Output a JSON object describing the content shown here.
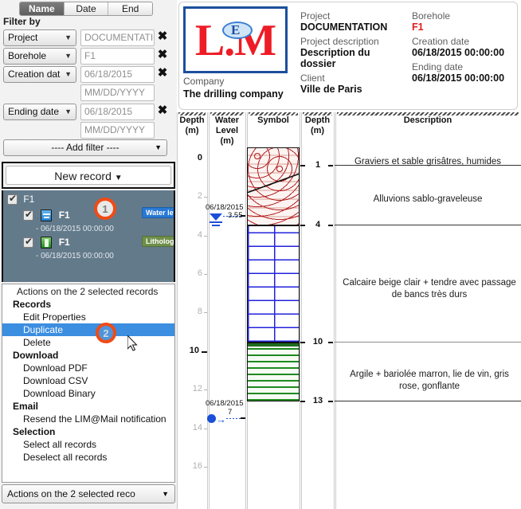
{
  "tabs": [
    {
      "label": "Name",
      "active": true
    },
    {
      "label": "Date",
      "active": false
    },
    {
      "label": "End",
      "active": false
    }
  ],
  "filter": {
    "title": "Filter by",
    "rows": [
      {
        "field": "Project",
        "value": "DOCUMENTATION",
        "placeholder": "",
        "second": null
      },
      {
        "field": "Borehole",
        "value": "F1",
        "placeholder": "",
        "second": null
      },
      {
        "field": "Creation dat",
        "value": "06/18/2015",
        "placeholder": "",
        "second": "MM/DD/YYYY"
      },
      {
        "field": "Ending date",
        "value": "06/18/2015",
        "placeholder": "",
        "second": "MM/DD/YYYY"
      }
    ],
    "add_filter": "---- Add filter ----",
    "clear_icon": "✖"
  },
  "new_record": {
    "label": "New record",
    "caret": "▾"
  },
  "records": {
    "root": {
      "label": "F1"
    },
    "items": [
      {
        "label": "F1",
        "sub": "- 06/18/2015 00:00:00",
        "icon": "water-level-icon",
        "badge": "Water level"
      },
      {
        "label": "F1",
        "sub": "- 06/18/2015 00:00:00",
        "icon": "lithology-icon",
        "badge": "Lithology"
      }
    ]
  },
  "actions_menu": {
    "header": "Actions on the 2 selected records",
    "groups": [
      {
        "title": "Records",
        "items": [
          "Edit Properties",
          "Duplicate",
          "Delete"
        ]
      },
      {
        "title": "Download",
        "items": [
          "Download PDF",
          "Download CSV",
          "Download Binary"
        ]
      },
      {
        "title": "Email",
        "items": [
          "Resend the LIM@Mail notification"
        ]
      },
      {
        "title": "Selection",
        "items": [
          "Select all records",
          "Deselect all records"
        ]
      }
    ],
    "selected": "Duplicate"
  },
  "actions_select": {
    "label": "Actions on the 2 selected reco",
    "caret": "▾"
  },
  "callouts": [
    {
      "number": "1"
    },
    {
      "number": "2"
    }
  ],
  "info_card": {
    "logo_text": "L.M",
    "logo_inner": "E",
    "company_label": "Company",
    "company_value": "The drilling company",
    "fields": [
      {
        "label": "Project",
        "value": "DOCUMENTATION",
        "red": false
      },
      {
        "label": "Project description",
        "value": "Description du dossier",
        "red": false
      },
      {
        "label": "Client",
        "value": "Ville de Paris",
        "red": false
      },
      {
        "label": "Borehole",
        "value": "F1",
        "red": true
      },
      {
        "label": "Creation date",
        "value": "06/18/2015 00:00:00",
        "red": false
      },
      {
        "label": "Ending date",
        "value": "06/18/2015 00:00:00",
        "red": false
      }
    ]
  },
  "log": {
    "columns": [
      "Depth (m)",
      "Water Level (m)",
      "Symbol",
      "Depth (m)",
      "Description"
    ],
    "depth_ticks": [
      {
        "v": 0,
        "major": true
      },
      {
        "v": 2,
        "major": false
      },
      {
        "v": 4,
        "major": false
      },
      {
        "v": 6,
        "major": false
      },
      {
        "v": 8,
        "major": false
      },
      {
        "v": 10,
        "major": true
      },
      {
        "v": 12,
        "major": false
      },
      {
        "v": 14,
        "major": false
      },
      {
        "v": 16,
        "major": false
      }
    ],
    "layers": [
      {
        "from": 0,
        "to": 1,
        "pattern": "gravel",
        "desc": "Graviers et sable grisâtres, humides"
      },
      {
        "from": 1,
        "to": 4,
        "pattern": "gravel",
        "desc": "Alluvions sablo-graveleuse"
      },
      {
        "from": 4,
        "to": 10,
        "pattern": "limestone",
        "desc": "Calcaire beige clair + tendre avec passage de bancs très durs"
      },
      {
        "from": 10,
        "to": 13,
        "pattern": "clay",
        "desc": "Argile + bariolée marron, lie de vin, gris rose, gonflante"
      }
    ],
    "boundaries": [
      "1",
      "4",
      "10",
      "13"
    ],
    "water_levels": [
      {
        "date": "06/18/2015",
        "value": "3.55",
        "depth": 3.55,
        "type": "static"
      },
      {
        "date": "06/18/2015",
        "value": "7",
        "depth": 7.0,
        "type": "arrival"
      }
    ]
  }
}
